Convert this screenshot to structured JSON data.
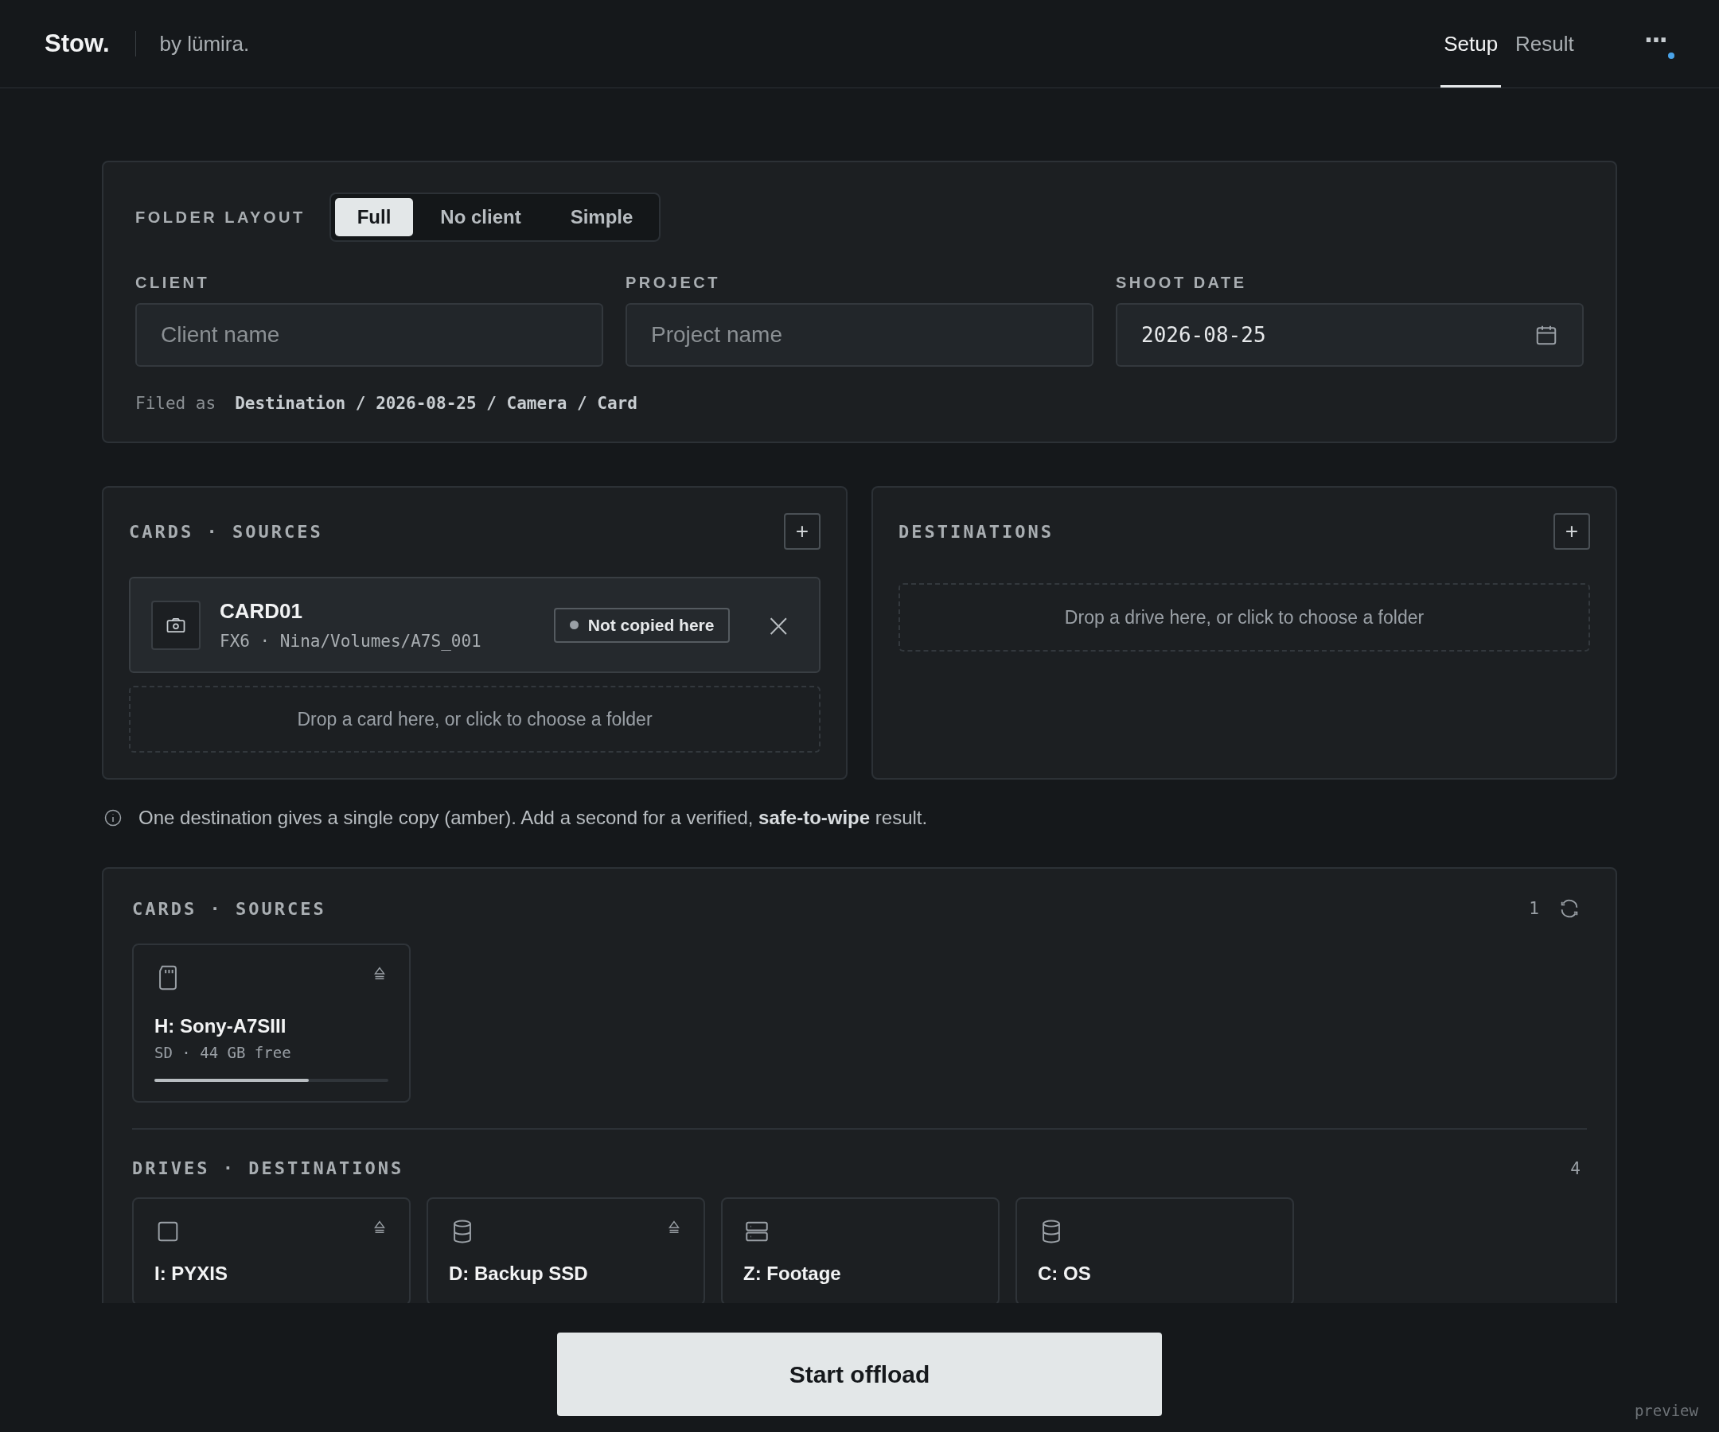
{
  "header": {
    "brand": "Stow.",
    "byline": "by lümira.",
    "tabs": [
      {
        "label": "Setup",
        "selected": true
      },
      {
        "label": "Result",
        "selected": false
      }
    ],
    "menu": {
      "label": "···",
      "has_notification": true
    }
  },
  "layout_panel": {
    "label": "FOLDER LAYOUT",
    "options": [
      {
        "label": "Full",
        "selected": true
      },
      {
        "label": "No client",
        "selected": false
      },
      {
        "label": "Simple",
        "selected": false
      }
    ],
    "fields": [
      {
        "kind": "text",
        "label": "CLIENT",
        "placeholder": "Client name"
      },
      {
        "kind": "text",
        "label": "PROJECT",
        "placeholder": "Project name"
      },
      {
        "kind": "date",
        "label": "SHOOT DATE",
        "value": "2026-08-25"
      }
    ],
    "filed_as_label": "Filed as",
    "filed_as_path": "Destination / 2026-08-25 / Camera / Card"
  },
  "sources_panel": {
    "title": "CARDS · SOURCES",
    "add": "+",
    "cards": [
      {
        "name": "CARD01",
        "meta": "FX6 · Nina/Volumes/A7S_001",
        "status": "Not copied here",
        "remove": "×"
      }
    ],
    "drop_hint": "Drop a card here, or click to choose a folder"
  },
  "destinations_panel": {
    "title": "DESTINATIONS",
    "add": "+",
    "drop_hint": "Drop a drive here, or click to choose a folder"
  },
  "info": "One destination gives a single copy (amber). Add a second for a verified, **safe-to-wipe** result.",
  "devices": {
    "cards_title": "CARDS · SOURCES",
    "cards_count": "1",
    "cards": [
      {
        "kind": "sd",
        "name": "H: Sony-A7SIII",
        "meta": "SD · 44 GB free",
        "ejectable": true,
        "level": 0.66
      }
    ],
    "drives_title": "DRIVES · DESTINATIONS",
    "drives_count": "4",
    "drives": [
      {
        "kind": "removable",
        "name": "I: PYXIS",
        "ejectable": true
      },
      {
        "kind": "disk",
        "name": "D: Backup SSD",
        "ejectable": true
      },
      {
        "kind": "network",
        "name": "Z: Footage",
        "ejectable": false
      },
      {
        "kind": "disk",
        "name": "C: OS",
        "ejectable": false
      }
    ]
  },
  "footer": {
    "action": "Start offload",
    "badge": "preview"
  }
}
